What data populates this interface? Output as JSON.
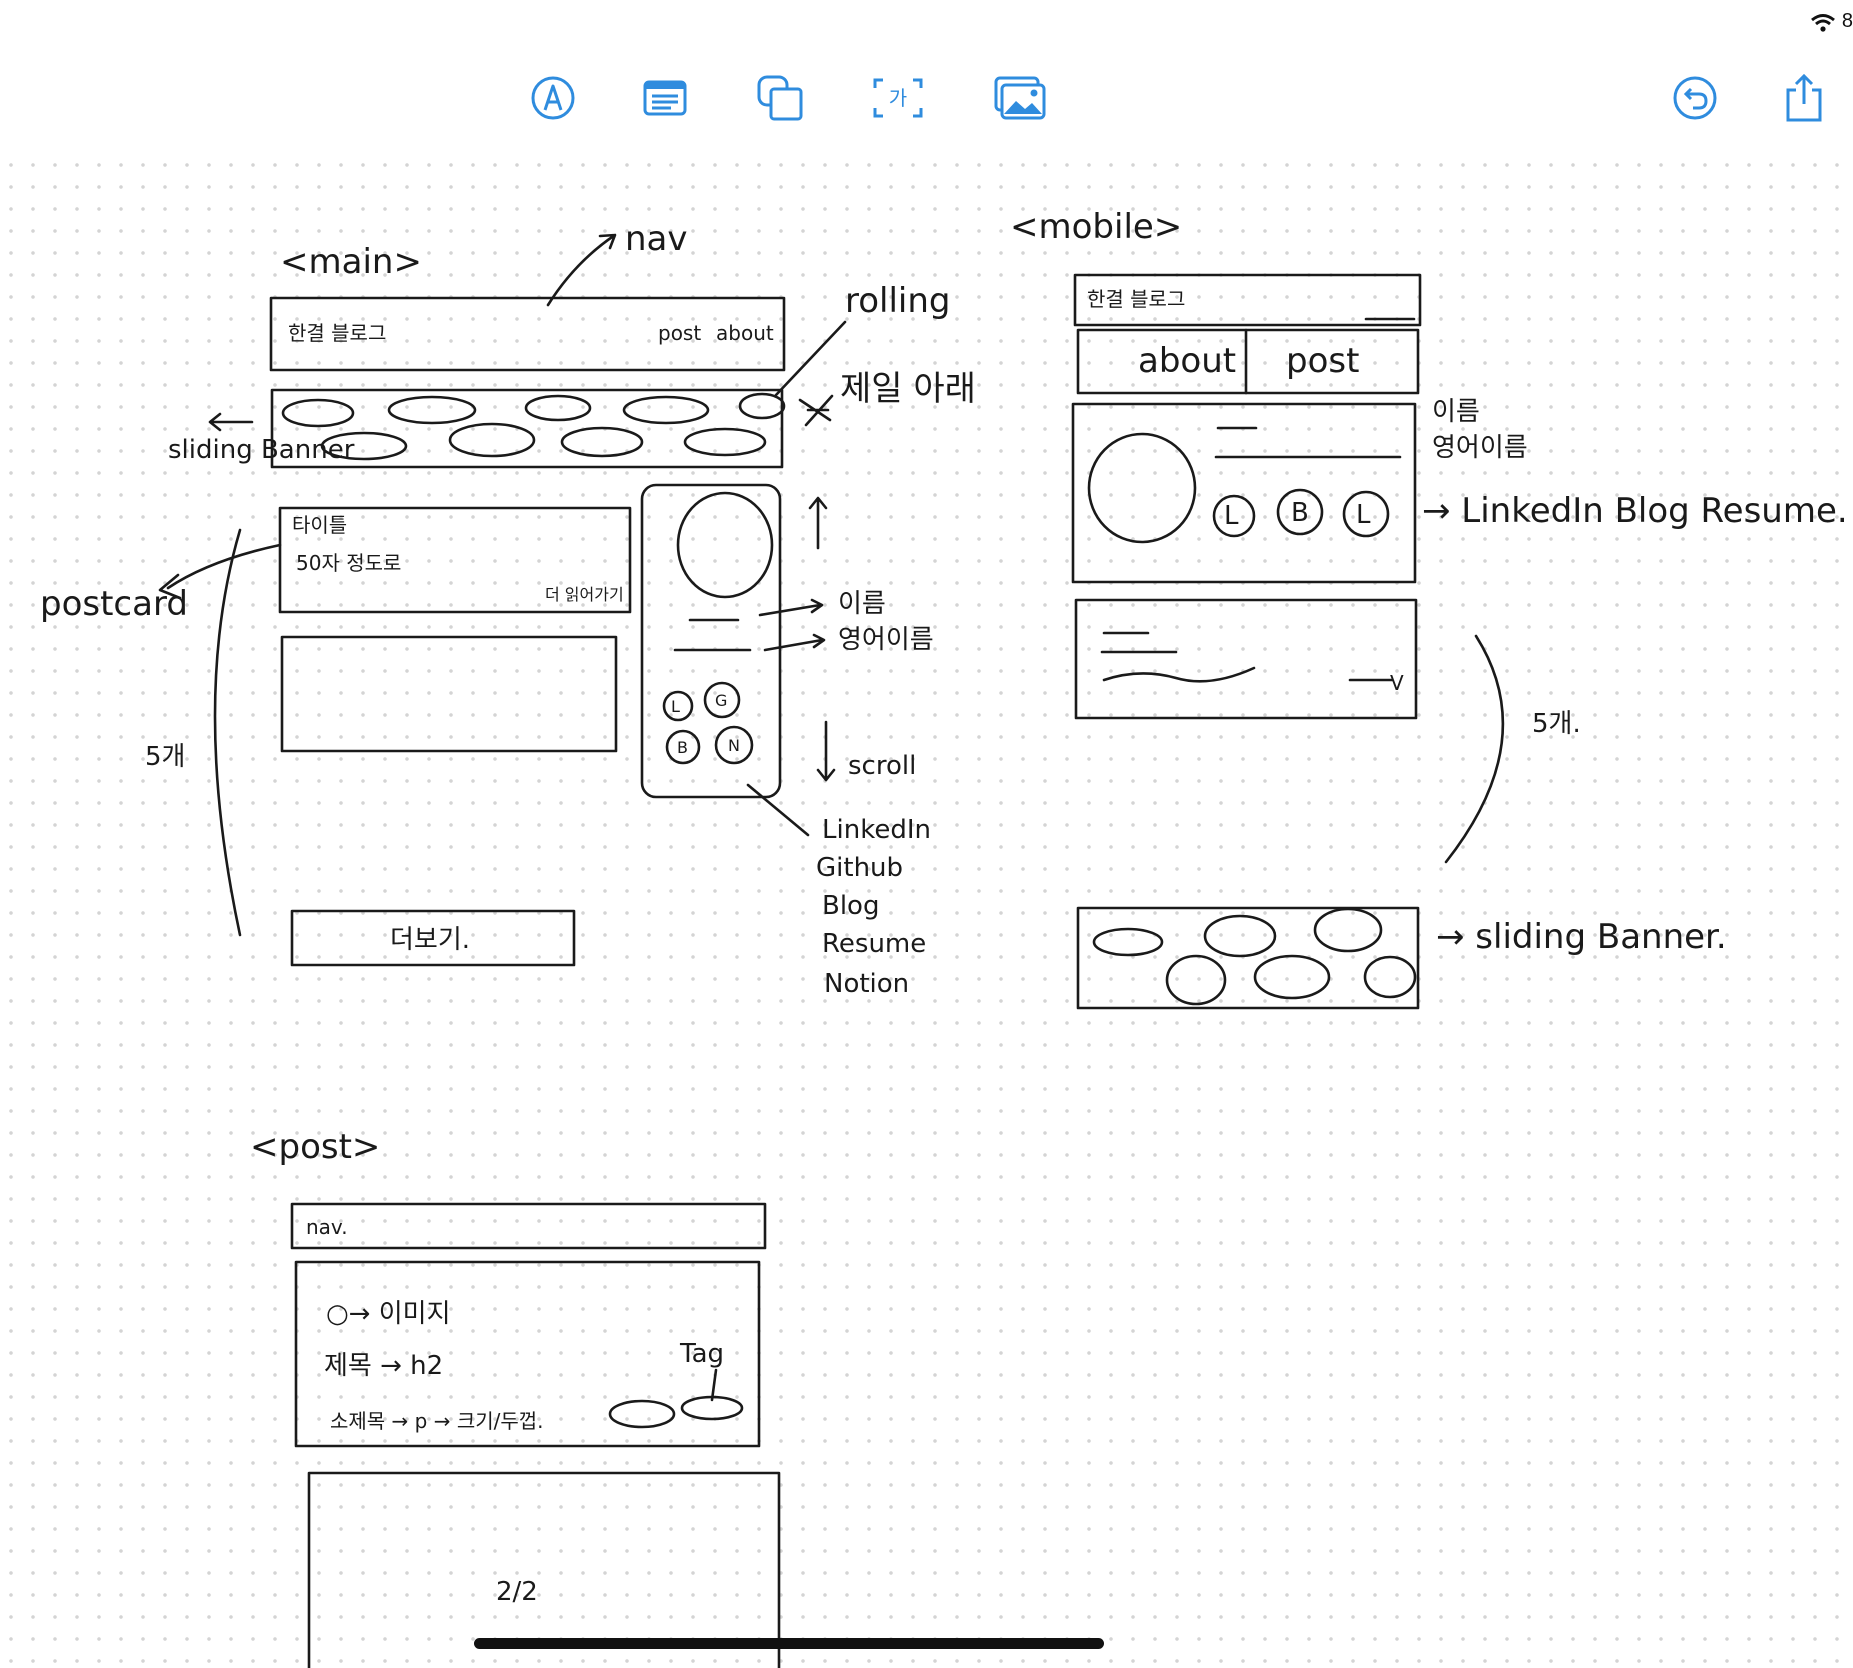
{
  "app": {
    "accent": "#2f8cde",
    "toolbar": [
      {
        "name": "markup-pen-icon"
      },
      {
        "name": "text-box-icon"
      },
      {
        "name": "shapes-icon"
      },
      {
        "name": "text-recognize-icon"
      },
      {
        "name": "insert-image-icon"
      }
    ],
    "undo_icon": "undo-icon",
    "share_icon": "share-icon",
    "status_battery": "8"
  },
  "sketch": {
    "main": {
      "heading": "<main>",
      "nav_label": "nav",
      "blog_name": "한결 블로그",
      "nav_post": "post",
      "nav_about": "about",
      "rolling": "rolling",
      "rolling_note": "제일 아래",
      "sliding_banner": "sliding Banner",
      "postcard": "postcard",
      "card_title": "타이틀",
      "card_summary": "50자 정도로",
      "card_more": "더 읽어가기",
      "count": "5개",
      "more_button": "더보기.",
      "name": "이름",
      "english_name": "영어이름",
      "scroll": "scroll",
      "badges": [
        "L",
        "G",
        "B",
        "N"
      ],
      "links": [
        "LinkedIn",
        "Github",
        "Blog",
        "Resume",
        "Notion"
      ]
    },
    "mobile": {
      "heading": "<mobile>",
      "blog_name": "한결 블로그",
      "tab_about": "about",
      "tab_post": "post",
      "name": "이름",
      "english_name": "영어이름",
      "badges": [
        "L",
        "B",
        "L"
      ],
      "links_note": "→ LinkedIn  Blog  Resume.",
      "count": "5개.",
      "card_more": "V",
      "sliding_banner": "→ sliding Banner."
    },
    "post": {
      "heading": "<post>",
      "nav": "nav.",
      "image_note": "○→ 이미지",
      "title_note": "제목 → h2",
      "subtitle_note": "소제목 → p → 크기/두껍.",
      "tag": "Tag",
      "page_number": "2/2"
    }
  }
}
